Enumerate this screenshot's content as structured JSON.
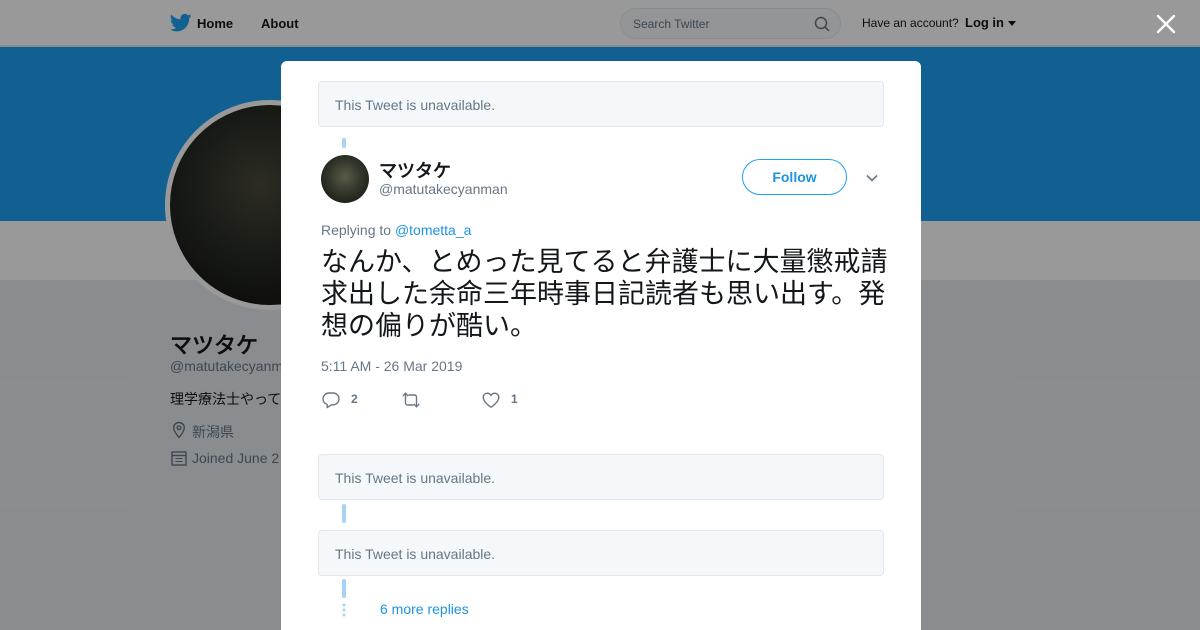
{
  "nav": {
    "home_label": "Home",
    "about_label": "About",
    "search_placeholder": "Search Twitter",
    "account_prompt": "Have an account?",
    "login_label": "Log in"
  },
  "profile": {
    "name": "マツタケ",
    "handle": "@matutakecyanm",
    "bio": "理学療法士やって",
    "location": "新潟県",
    "joined": "Joined June 2"
  },
  "modal": {
    "unavailable_text": "This Tweet is unavailable.",
    "tweet": {
      "author_name": "マツタケ",
      "author_handle": "@matutakecyanman",
      "follow_label": "Follow",
      "replying_prefix": "Replying to",
      "replying_handle": "@tometta_a",
      "text": "なんか、とめった見てると弁護士に大量懲戒請求出した余命三年時事日記読者も思い出す。発想の偏りが酷い。",
      "timestamp": "5:11 AM - 26 Mar 2019",
      "reply_count": "2",
      "retweet_count": "",
      "like_count": "1"
    },
    "more_replies_label": "6 more replies"
  },
  "colors": {
    "accent": "#1da1f2",
    "link": "#1b95e0",
    "muted": "#657786",
    "thread_line": "#a6d3f5"
  },
  "icons": [
    "twitter-bird-icon",
    "search-icon",
    "close-icon",
    "chevron-down-icon",
    "reply-icon",
    "retweet-icon",
    "heart-icon",
    "location-icon",
    "calendar-icon"
  ]
}
